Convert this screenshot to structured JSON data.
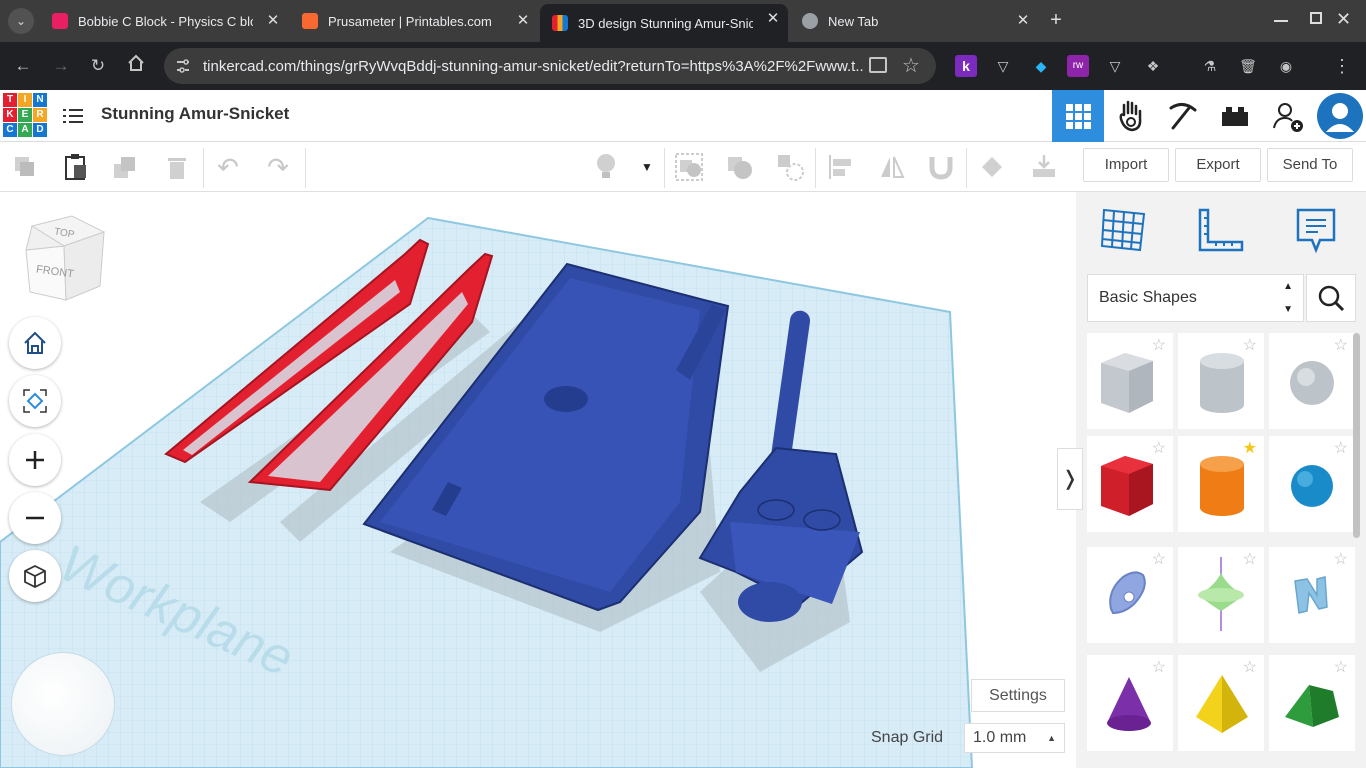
{
  "browser": {
    "tabs": [
      {
        "title": "Bobbie C Block - Physics C bloc",
        "favicon_color": "#e91e63"
      },
      {
        "title": "Prusameter | Printables.com",
        "favicon_color": "#fa6831"
      },
      {
        "title": "3D design Stunning Amur-Snick",
        "favicon_color": "#1477d1",
        "active": true
      },
      {
        "title": "New Tab",
        "favicon_color": "#9aa0a6"
      }
    ],
    "url": "tinkercad.com/things/grRyWvqBddj-stunning-amur-snicket/edit?returnTo=https%3A%2F%2Fwww.t...",
    "new_tab_icon": "+",
    "ext_k_label": "k",
    "ext_rw_label": "rw"
  },
  "app": {
    "logo_letters": [
      "TIN",
      "KER",
      "CAD"
    ],
    "design_title": "Stunning Amur-Snicket"
  },
  "toolbar": {
    "import_label": "Import",
    "export_label": "Export",
    "send_to_label": "Send To"
  },
  "viewcube": {
    "top": "TOP",
    "front": "FRONT"
  },
  "workplane_label": "Workplane",
  "right_panel": {
    "category": "Basic Shapes",
    "collapse_label": "❭",
    "shapes": [
      {
        "name": "box-hole",
        "favorited": false
      },
      {
        "name": "cylinder-hole",
        "favorited": false
      },
      {
        "name": "sphere-hole",
        "favorited": false
      },
      {
        "name": "box",
        "favorited": false
      },
      {
        "name": "cylinder",
        "favorited": true
      },
      {
        "name": "sphere",
        "favorited": false
      },
      {
        "name": "scribble",
        "favorited": false
      },
      {
        "name": "polygon-spinner",
        "favorited": false
      },
      {
        "name": "text-shape",
        "favorited": false
      },
      {
        "name": "cone",
        "favorited": false
      },
      {
        "name": "pyramid",
        "favorited": false
      },
      {
        "name": "roof",
        "favorited": false
      }
    ]
  },
  "bottom": {
    "settings_label": "Settings",
    "snap_grid_label": "Snap Grid",
    "snap_grid_value": "1.0 mm"
  },
  "colors": {
    "accent_blue": "#2e8ddc",
    "model_blue": "#2f4ba6",
    "model_red": "#e22030",
    "workplane": "#d7ecf6"
  }
}
